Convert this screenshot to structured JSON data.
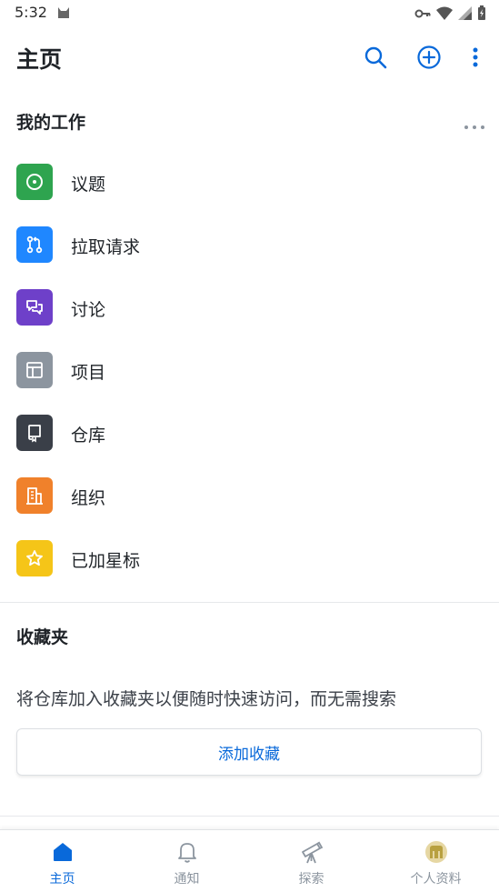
{
  "status_bar": {
    "time": "5:32"
  },
  "app_bar": {
    "title": "主页"
  },
  "my_work": {
    "header": "我的工作",
    "items": [
      {
        "label": "议题",
        "icon": "issue-icon",
        "color": "#2ea44f"
      },
      {
        "label": "拉取请求",
        "icon": "pull-request-icon",
        "color": "#1f87ff"
      },
      {
        "label": "讨论",
        "icon": "discussion-icon",
        "color": "#6e40c9"
      },
      {
        "label": "项目",
        "icon": "project-icon",
        "color": "#8c959f"
      },
      {
        "label": "仓库",
        "icon": "repository-icon",
        "color": "#3a3f48"
      },
      {
        "label": "组织",
        "icon": "organization-icon",
        "color": "#f0812b"
      },
      {
        "label": "已加星标",
        "icon": "star-icon",
        "color": "#f5c518"
      }
    ]
  },
  "favorites": {
    "header": "收藏夹",
    "description": "将仓库加入收藏夹以便随时快速访问，而无需搜索",
    "add_button": "添加收藏"
  },
  "bottom_nav": {
    "items": [
      {
        "label": "主页",
        "icon": "home-icon",
        "active": true
      },
      {
        "label": "通知",
        "icon": "bell-icon",
        "active": false
      },
      {
        "label": "探索",
        "icon": "telescope-icon",
        "active": false
      },
      {
        "label": "个人资料",
        "icon": "avatar",
        "active": false
      }
    ]
  },
  "colors": {
    "accent": "#0969da",
    "text": "#1f2328",
    "muted": "#8c959f"
  }
}
